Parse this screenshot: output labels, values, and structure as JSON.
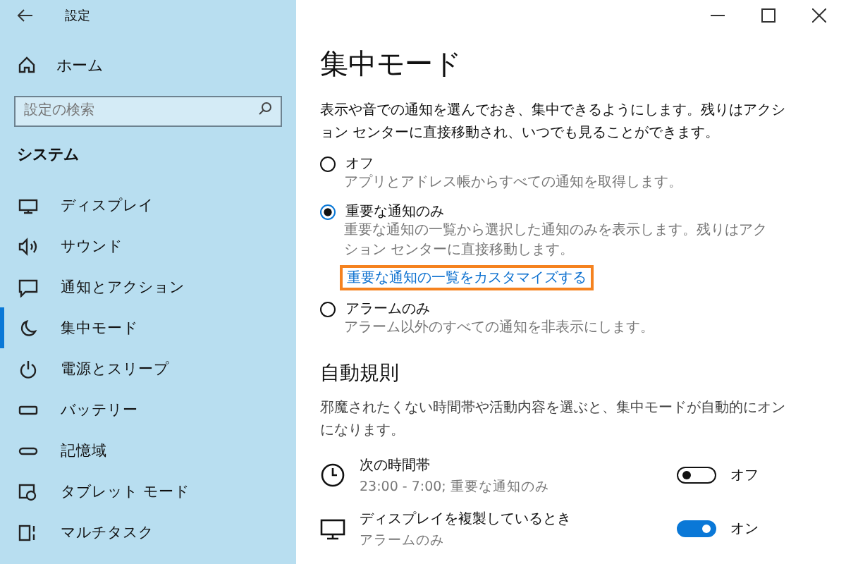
{
  "window": {
    "title": "設定"
  },
  "sidebar": {
    "home": "ホーム",
    "search": {
      "placeholder": "設定の検索"
    },
    "section": "システム",
    "items": [
      {
        "label": "ディスプレイ",
        "selected": false
      },
      {
        "label": "サウンド",
        "selected": false
      },
      {
        "label": "通知とアクション",
        "selected": false
      },
      {
        "label": "集中モード",
        "selected": true
      },
      {
        "label": "電源とスリープ",
        "selected": false
      },
      {
        "label": "バッテリー",
        "selected": false
      },
      {
        "label": "記憶域",
        "selected": false
      },
      {
        "label": "タブレット モード",
        "selected": false
      },
      {
        "label": "マルチタスク",
        "selected": false
      }
    ]
  },
  "page": {
    "title": "集中モード",
    "description": "表示や音での通知を選んでおき、集中できるようにします。残りはアクション センターに直接移動され、いつでも見ることができます。",
    "options": [
      {
        "label": "オフ",
        "description": "アプリとアドレス帳からすべての通知を取得します。",
        "selected": false
      },
      {
        "label": "重要な通知のみ",
        "description": "重要な通知の一覧から選択した通知のみを表示します。残りはアクション センターに直接移動します。",
        "link": "重要な通知の一覧をカスタマイズする",
        "selected": true
      },
      {
        "label": "アラームのみ",
        "description": "アラーム以外のすべての通知を非表示にします。",
        "selected": false
      }
    ],
    "rules_title": "自動規則",
    "rules_description": "邪魔されたくない時間帯や活動内容を選ぶと、集中モードが自動的にオンになります。",
    "rules": [
      {
        "name": "次の時間帯",
        "detail": "23:00 - 7:00; 重要な通知のみ",
        "on": false,
        "state": "オフ"
      },
      {
        "name": "ディスプレイを複製しているとき",
        "detail": "アラームのみ",
        "on": true,
        "state": "オン"
      }
    ]
  }
}
